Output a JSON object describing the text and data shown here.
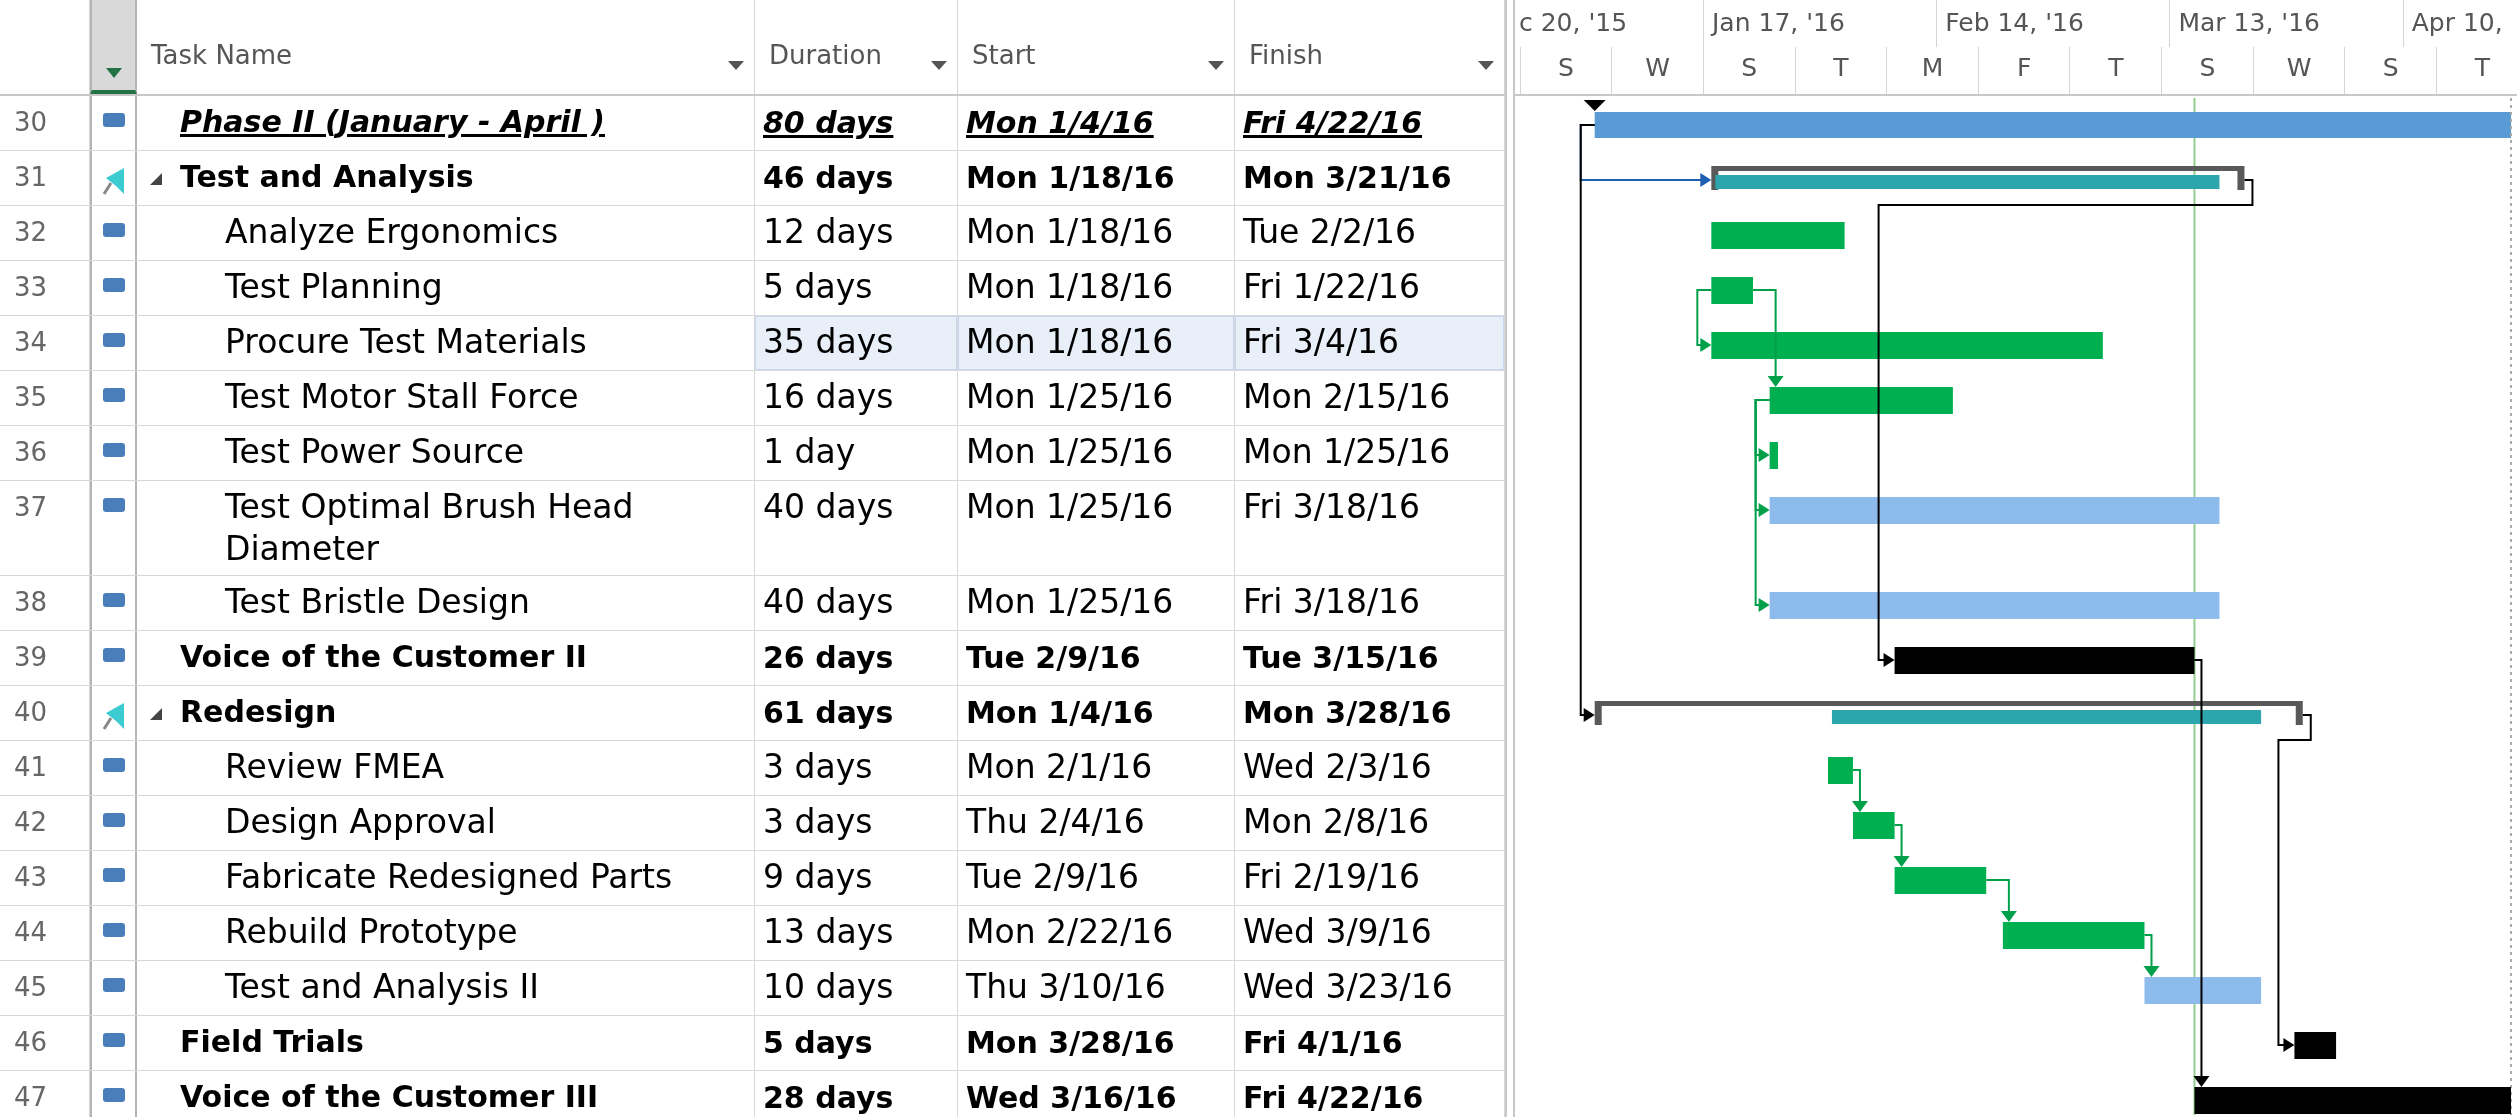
{
  "columns": [
    {
      "label": "Task Name"
    },
    {
      "label": "Duration"
    },
    {
      "label": "Start"
    },
    {
      "label": "Finish"
    }
  ],
  "timescale": {
    "major": [
      "c 20, '15",
      "Jan 17, '16",
      "Feb 14, '16",
      "Mar 13, '16",
      "Apr 10,"
    ],
    "minor": [
      "S",
      "W",
      "S",
      "T",
      "M",
      "F",
      "T",
      "S",
      "W",
      "S",
      "T"
    ]
  },
  "tasks": [
    {
      "id": "30",
      "kind": "phase",
      "manual": false,
      "name": "Phase II (January - April )",
      "duration": "80 days",
      "start": "Mon 1/4/16",
      "finish": "Fri 4/22/16",
      "selected": false
    },
    {
      "id": "31",
      "kind": "summary",
      "manual": true,
      "expanded": true,
      "name": "Test and Analysis",
      "duration": "46 days",
      "start": "Mon 1/18/16",
      "finish": "Mon 3/21/16",
      "selected": false,
      "children": [
        {
          "id": "32",
          "kind": "task",
          "manual": false,
          "name": "Analyze Ergonomics",
          "duration": "12 days",
          "start": "Mon 1/18/16",
          "finish": "Tue 2/2/16",
          "selected": false,
          "color": "#00b050"
        },
        {
          "id": "33",
          "kind": "task",
          "manual": false,
          "name": "Test Planning",
          "duration": "5 days",
          "start": "Mon 1/18/16",
          "finish": "Fri 1/22/16",
          "selected": false,
          "color": "#00b050"
        },
        {
          "id": "34",
          "kind": "task",
          "manual": false,
          "name": "Procure Test Materials",
          "duration": "35 days",
          "start": "Mon 1/18/16",
          "finish": "Fri 3/4/16",
          "selected": true,
          "color": "#00b050"
        },
        {
          "id": "35",
          "kind": "task",
          "manual": false,
          "name": "Test Motor Stall Force",
          "duration": "16 days",
          "start": "Mon 1/25/16",
          "finish": "Mon 2/15/16",
          "selected": false,
          "color": "#00b050"
        },
        {
          "id": "36",
          "kind": "task",
          "manual": false,
          "name": "Test Power Source",
          "duration": "1 day",
          "start": "Mon 1/25/16",
          "finish": "Mon 1/25/16",
          "selected": false,
          "color": "#00b050"
        },
        {
          "id": "37",
          "kind": "task",
          "manual": false,
          "name": "Test Optimal Brush Head Diameter",
          "duration": "40 days",
          "start": "Mon 1/25/16",
          "finish": "Fri 3/18/16",
          "selected": false,
          "color": "#8dbbeb"
        },
        {
          "id": "38",
          "kind": "task",
          "manual": false,
          "name": "Test Bristle Design",
          "duration": "40 days",
          "start": "Mon 1/25/16",
          "finish": "Fri 3/18/16",
          "selected": false,
          "color": "#8dbbeb"
        }
      ]
    },
    {
      "id": "39",
      "kind": "major",
      "manual": false,
      "name": "Voice of the Customer II",
      "duration": "26 days",
      "start": "Tue 2/9/16",
      "finish": "Tue 3/15/16",
      "selected": false,
      "color": "#000000"
    },
    {
      "id": "40",
      "kind": "summary",
      "manual": true,
      "expanded": true,
      "name": "Redesign",
      "duration": "61 days",
      "start": "Mon 1/4/16",
      "finish": "Mon 3/28/16",
      "selected": false,
      "children": [
        {
          "id": "41",
          "kind": "task",
          "manual": false,
          "name": "Review FMEA",
          "duration": "3 days",
          "start": "Mon 2/1/16",
          "finish": "Wed 2/3/16",
          "selected": false,
          "color": "#00b050"
        },
        {
          "id": "42",
          "kind": "task",
          "manual": false,
          "name": "Design Approval",
          "duration": "3 days",
          "start": "Thu 2/4/16",
          "finish": "Mon 2/8/16",
          "selected": false,
          "color": "#00b050"
        },
        {
          "id": "43",
          "kind": "task",
          "manual": false,
          "name": "Fabricate Redesigned Parts",
          "duration": "9 days",
          "start": "Tue 2/9/16",
          "finish": "Fri 2/19/16",
          "selected": false,
          "color": "#00b050"
        },
        {
          "id": "44",
          "kind": "task",
          "manual": false,
          "name": "Rebuild Prototype",
          "duration": "13 days",
          "start": "Mon 2/22/16",
          "finish": "Wed 3/9/16",
          "selected": false,
          "color": "#00b050"
        },
        {
          "id": "45",
          "kind": "task",
          "manual": false,
          "name": "Test and Analysis II",
          "duration": "10 days",
          "start": "Thu 3/10/16",
          "finish": "Wed 3/23/16",
          "selected": false,
          "color": "#8dbbeb"
        }
      ]
    },
    {
      "id": "46",
      "kind": "major",
      "manual": false,
      "name": "Field Trials",
      "duration": "5 days",
      "start": "Mon 3/28/16",
      "finish": "Fri 4/1/16",
      "selected": false,
      "color": "#000000"
    },
    {
      "id": "47",
      "kind": "major",
      "manual": false,
      "name": "Voice of the Customer III",
      "duration": "28 days",
      "start": "Wed 3/16/16",
      "finish": "Fri 4/22/16",
      "selected": false,
      "color": "#000000"
    }
  ]
}
